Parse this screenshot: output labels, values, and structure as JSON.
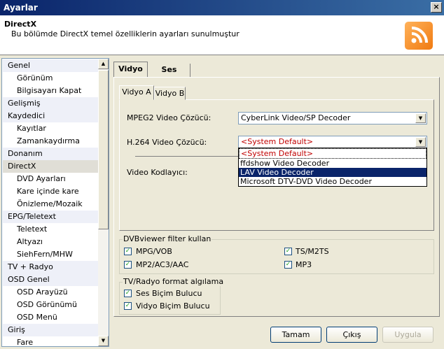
{
  "window": {
    "title": "Ayarlar",
    "close": "×"
  },
  "header": {
    "title": "DirectX",
    "subtitle": "Bu bölümde DirectX temel özelliklerin ayarları sunulmuştur",
    "icon": "rss-icon"
  },
  "sidebar": {
    "items": [
      {
        "label": "Genel",
        "kind": "cat"
      },
      {
        "label": "Görünüm",
        "kind": "sub"
      },
      {
        "label": "Bilgisayarı Kapat",
        "kind": "sub"
      },
      {
        "label": "Gelişmiş",
        "kind": "cat"
      },
      {
        "label": "Kaydedici",
        "kind": "cat"
      },
      {
        "label": "Kayıtlar",
        "kind": "sub"
      },
      {
        "label": "Zamankaydırma",
        "kind": "sub"
      },
      {
        "label": "Donanım",
        "kind": "cat"
      },
      {
        "label": "DirectX",
        "kind": "cat",
        "selected": true
      },
      {
        "label": "DVD Ayarları",
        "kind": "sub"
      },
      {
        "label": "Kare içinde kare",
        "kind": "sub"
      },
      {
        "label": "Önizleme/Mozaik",
        "kind": "sub"
      },
      {
        "label": "EPG/Teletext",
        "kind": "cat"
      },
      {
        "label": "Teletext",
        "kind": "sub"
      },
      {
        "label": "Altyazı",
        "kind": "sub"
      },
      {
        "label": "SiehFern/MHW",
        "kind": "sub"
      },
      {
        "label": "TV + Radyo",
        "kind": "cat"
      },
      {
        "label": "OSD Genel",
        "kind": "cat"
      },
      {
        "label": "OSD Arayüzü",
        "kind": "sub"
      },
      {
        "label": "OSD Görünümü",
        "kind": "sub"
      },
      {
        "label": "OSD Menü",
        "kind": "sub"
      },
      {
        "label": "Giriş",
        "kind": "cat"
      },
      {
        "label": "Fare",
        "kind": "sub"
      }
    ]
  },
  "tabs": {
    "vidyo": "Vidyo",
    "ses": "Ses"
  },
  "subtabs": {
    "a": "Vidyo A",
    "b": "Vidyo B"
  },
  "video": {
    "mpeg2_label": "MPEG2 Video Çözücü:",
    "mpeg2_value": "CyberLink Video/SP Decoder",
    "h264_label": "H.264 Video Çözücü:",
    "h264_value": "<System Default>",
    "encoder_label": "Video Kodlayıcı:",
    "dropdown_options": [
      "<System Default>",
      "ffdshow Video Decoder",
      "LAV Video Decoder",
      "Microsoft DTV-DVD Video Decoder"
    ],
    "highlighted_option": "LAV Video Decoder"
  },
  "filter_group": {
    "title": "DVBviewer filter kullan",
    "items": [
      {
        "label": "MPG/VOB",
        "checked": true
      },
      {
        "label": "TS/M2TS",
        "checked": true
      },
      {
        "label": "MP2/AC3/AAC",
        "checked": true
      },
      {
        "label": "MP3",
        "checked": true
      }
    ]
  },
  "format_group": {
    "title": "TV/Radyo format algılama",
    "items": [
      {
        "label": "Ses Biçim Bulucu",
        "checked": true
      },
      {
        "label": "Vidyo Biçim Bulucu",
        "checked": true
      }
    ]
  },
  "buttons": {
    "ok": "Tamam",
    "exit": "Çıkış",
    "apply": "Uygula"
  },
  "colors": {
    "title_bar": "#0a246a",
    "highlight": "#0a246a",
    "default_text": "#c00000"
  }
}
